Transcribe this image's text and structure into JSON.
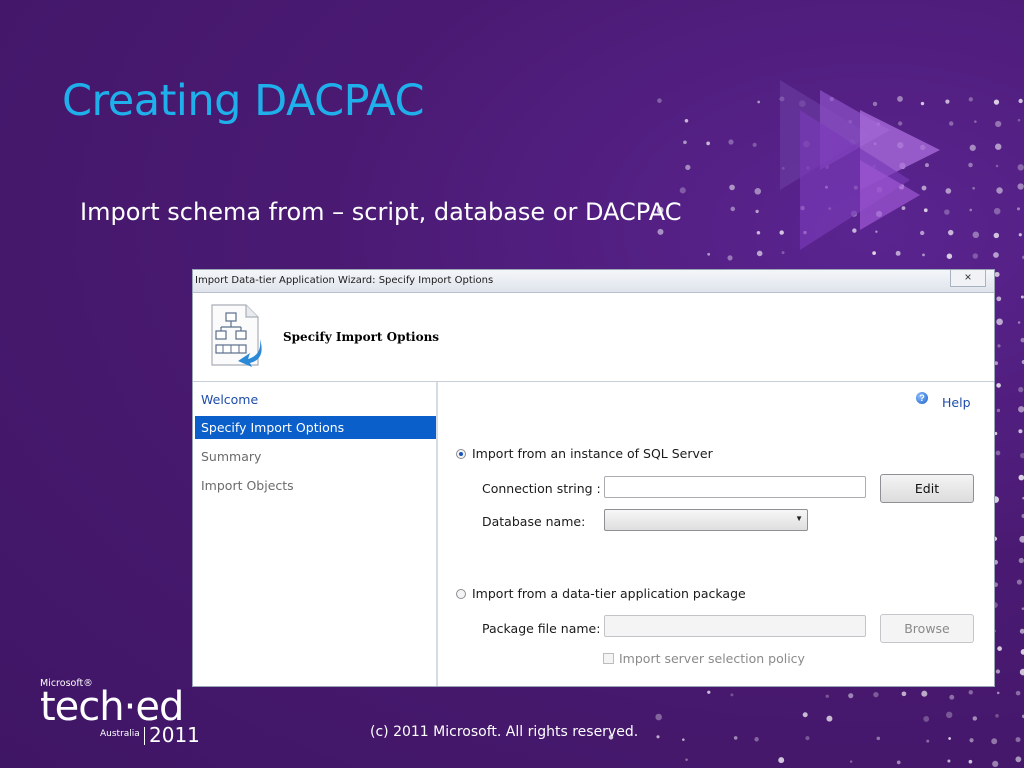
{
  "slide": {
    "title": "Creating DACPAC",
    "subtitle": "Import schema from – script, database or DACPAC",
    "copyright": "(c) 2011 Microsoft. All rights reserved."
  },
  "logo": {
    "microsoft": "Microsoft®",
    "teched": "tech·ed",
    "region": "Australia",
    "year": "2011"
  },
  "dialog": {
    "title": "Import Data-tier Application Wizard: Specify Import Options",
    "close_glyph": "×",
    "header_title": "Specify Import Options",
    "help_label": "Help",
    "nav": [
      {
        "label": "Welcome",
        "state": "link"
      },
      {
        "label": "Specify Import Options",
        "state": "selected"
      },
      {
        "label": "Summary",
        "state": "disabled"
      },
      {
        "label": "Import Objects",
        "state": "disabled"
      }
    ],
    "option_sql": {
      "label": "Import from an instance of SQL Server",
      "selected": true,
      "connection_label": "Connection string :",
      "connection_value": "",
      "edit_button": "Edit",
      "database_label": "Database name:",
      "database_value": ""
    },
    "option_package": {
      "label": "Import from a data-tier application package",
      "selected": false,
      "package_label": "Package file name:",
      "package_value": "",
      "browse_button": "Browse",
      "policy_label": "Import server selection policy",
      "policy_checked": false
    }
  },
  "colors": {
    "background": "#4a1a72",
    "title": "#1fb0ec",
    "nav_selected": "#0a5fcb",
    "link": "#1e4ca8"
  }
}
